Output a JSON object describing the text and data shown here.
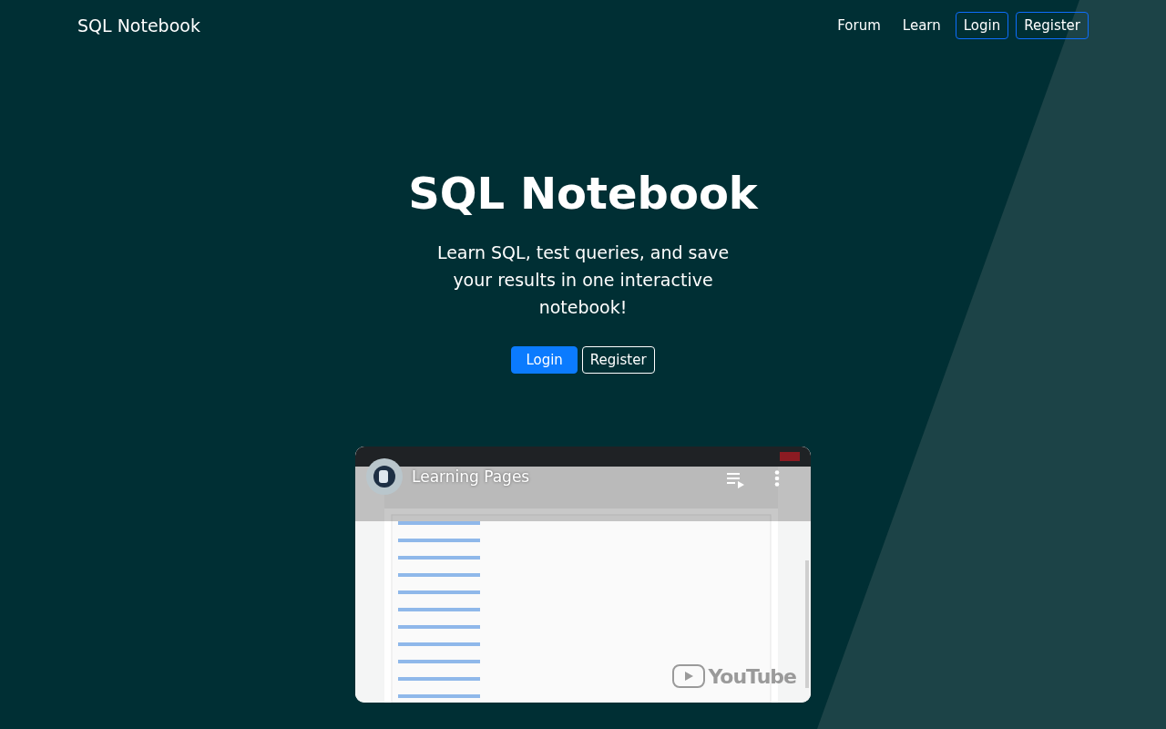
{
  "navbar": {
    "brand": "SQL Notebook",
    "links": [
      {
        "label": "Forum",
        "kind": "link"
      },
      {
        "label": "Learn",
        "kind": "link"
      },
      {
        "label": "Login",
        "kind": "outline"
      },
      {
        "label": "Register",
        "kind": "outline"
      }
    ]
  },
  "hero": {
    "title": "SQL Notebook",
    "subtitle": "Learn SQL, test queries, and save your results in one interactive notebook!",
    "buttons": [
      {
        "label": "Login",
        "kind": "primary"
      },
      {
        "label": "Register",
        "kind": "outline"
      }
    ]
  },
  "video": {
    "kind": "picture",
    "title": "Learning Pages",
    "logo": "YouTube"
  }
}
